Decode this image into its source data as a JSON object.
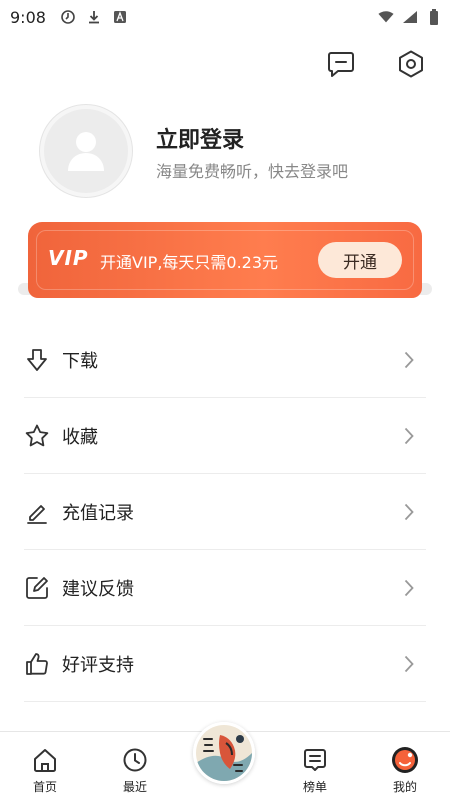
{
  "status_bar": {
    "time": "9:08",
    "left_icons": [
      "clock-circle-icon",
      "download-arrow-icon",
      "a-box-icon"
    ],
    "right_icons": [
      "wifi-icon",
      "signal-icon",
      "battery-icon"
    ]
  },
  "header_actions": [
    {
      "icon": "message-icon"
    },
    {
      "icon": "settings-icon"
    }
  ],
  "profile": {
    "login_title": "立即登录",
    "login_subtitle": "海量免费畅听，快去登录吧"
  },
  "vip": {
    "logo": "VIP",
    "text": "开通VIP,每天只需0.23元",
    "button": "开通",
    "colors": {
      "start": "#f0643b",
      "end": "#ff7d4e",
      "button_bg": "#fde8d8"
    }
  },
  "menu": [
    {
      "label": "下载",
      "icon": "download-icon"
    },
    {
      "label": "收藏",
      "icon": "star-icon"
    },
    {
      "label": "充值记录",
      "icon": "pencil-icon"
    },
    {
      "label": "建议反馈",
      "icon": "edit-square-icon"
    },
    {
      "label": "好评支持",
      "icon": "thumbs-up-icon"
    }
  ],
  "bottom_nav": [
    {
      "label": "首页",
      "icon": "home-icon"
    },
    {
      "label": "最近",
      "icon": "clock-icon"
    },
    {
      "label": "",
      "icon": "player-cover-icon"
    },
    {
      "label": "榜单",
      "icon": "list-icon"
    },
    {
      "label": "我的",
      "icon": "profile-active-icon",
      "active": true
    }
  ],
  "accent_color": "#f5623a"
}
